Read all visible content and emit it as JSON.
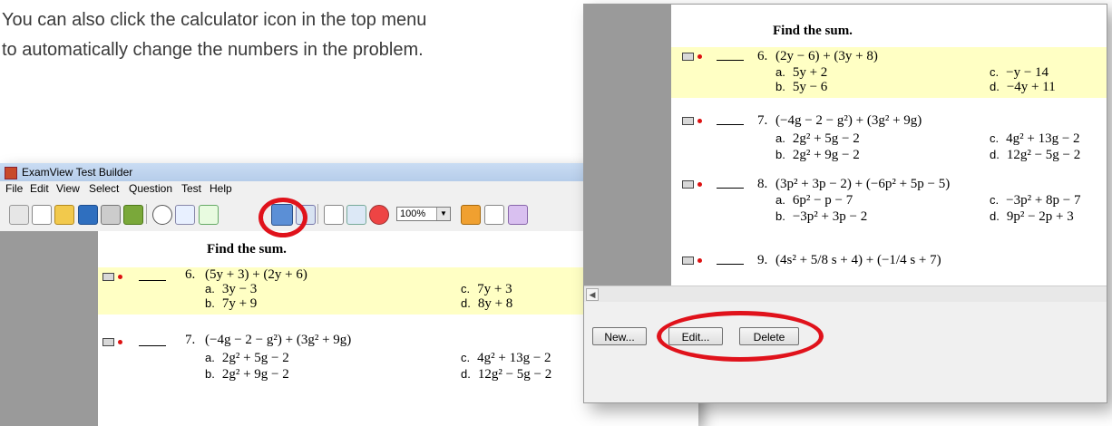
{
  "instructions": "You can also click the calculator icon in the top menu to automatically change the numbers in the problem.",
  "window_main": {
    "title": "ExamView Test Builder",
    "menu": [
      "File",
      "Edit",
      "View",
      "Select",
      "Question",
      "Test",
      "Help"
    ],
    "zoom": "100%",
    "section_heading": "Find the sum.",
    "questions": [
      {
        "num": "6.",
        "stem": "(5y + 3) + (2y + 6)",
        "a": "3y − 3",
        "b": "7y + 9",
        "c": "7y + 3",
        "d": "8y + 8"
      },
      {
        "num": "7.",
        "stem": "(−4g − 2 − g²) + (3g² + 9g)",
        "a": "2g² + 5g − 2",
        "b": "2g² + 9g − 2",
        "c": "4g² + 13g − 2",
        "d": "12g² − 5g − 2"
      }
    ]
  },
  "window_edit": {
    "section_heading": "Find the sum.",
    "questions": [
      {
        "num": "6.",
        "stem": "(2y − 6) + (3y + 8)",
        "a": "5y + 2",
        "b": "5y − 6",
        "c": "−y − 14",
        "d": "−4y + 11"
      },
      {
        "num": "7.",
        "stem": "(−4g − 2 − g²) + (3g² + 9g)",
        "a": "2g² + 5g − 2",
        "b": "2g² + 9g − 2",
        "c": "4g² + 13g − 2",
        "d": "12g² − 5g − 2"
      },
      {
        "num": "8.",
        "stem": "(3p² + 3p − 2) + (−6p² + 5p − 5)",
        "a": "6p² − p − 7",
        "b": "−3p² + 3p − 2",
        "c": "−3p² + 8p − 7",
        "d": "9p² − 2p + 3"
      },
      {
        "num": "9.",
        "stem": "(4s² + 5/8 s + 4) + (−1/4 s + 7)"
      }
    ],
    "buttons": {
      "new": "New...",
      "edit": "Edit...",
      "delete": "Delete"
    }
  },
  "option_letters": {
    "a": "a.",
    "b": "b.",
    "c": "c.",
    "d": "d."
  },
  "colors": {
    "highlight": "#ffffc4",
    "annotation_red": "#e0121b"
  }
}
